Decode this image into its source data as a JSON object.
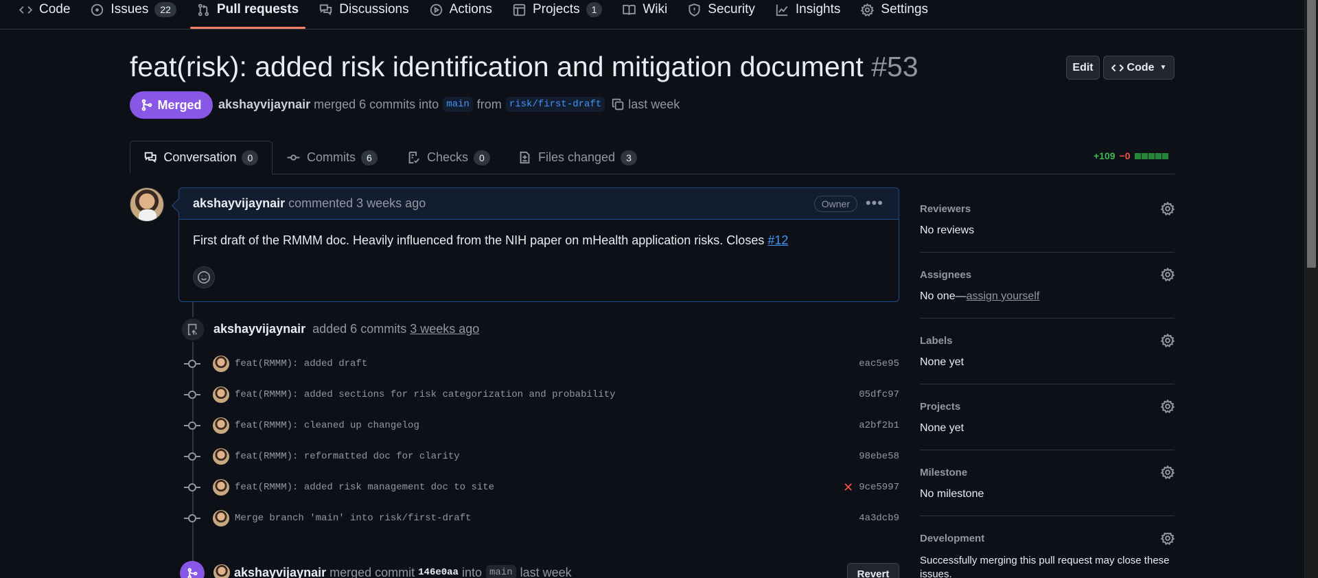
{
  "nav": {
    "items": [
      {
        "label": "Code",
        "icon": "code-icon"
      },
      {
        "label": "Issues",
        "icon": "issue-icon",
        "count": "22"
      },
      {
        "label": "Pull requests",
        "icon": "git-pull-request-icon",
        "active": true
      },
      {
        "label": "Discussions",
        "icon": "comment-discussion-icon"
      },
      {
        "label": "Actions",
        "icon": "play-icon"
      },
      {
        "label": "Projects",
        "icon": "table-icon",
        "count": "1"
      },
      {
        "label": "Wiki",
        "icon": "book-icon"
      },
      {
        "label": "Security",
        "icon": "shield-icon"
      },
      {
        "label": "Insights",
        "icon": "graph-icon"
      },
      {
        "label": "Settings",
        "icon": "gear-icon"
      }
    ]
  },
  "pr": {
    "title": "feat(risk): added risk identification and mitigation document",
    "number": "#53",
    "edit_label": "Edit",
    "code_label": "Code",
    "state": "Merged",
    "author": "akshayvijaynair",
    "merge_text": "merged 6 commits into",
    "base_branch": "main",
    "from_text": "from",
    "head_branch": "risk/first-draft",
    "when": "last week"
  },
  "tabs": [
    {
      "label": "Conversation",
      "count": "0",
      "icon": "comment-discussion-icon"
    },
    {
      "label": "Commits",
      "count": "6",
      "icon": "git-commit-icon"
    },
    {
      "label": "Checks",
      "count": "0",
      "icon": "checklist-icon"
    },
    {
      "label": "Files changed",
      "count": "3",
      "icon": "file-diff-icon"
    }
  ],
  "diffstat": {
    "additions": "+109",
    "deletions": "−0",
    "accent": "#238636"
  },
  "comment": {
    "author": "akshayvijaynair",
    "action": "commented 3 weeks ago",
    "badge": "Owner",
    "body": "First draft of the RMMM doc. Heavily influenced from the NIH paper on mHealth application risks. Closes ",
    "link": "#12"
  },
  "push_event": {
    "author": "akshayvijaynair",
    "text": "added 6 commits",
    "when": "3 weeks ago"
  },
  "commits": [
    {
      "message": "feat(RMMM): added draft",
      "sha": "eac5e95",
      "status": ""
    },
    {
      "message": "feat(RMMM): added sections for risk categorization and probability",
      "sha": "05dfc97",
      "status": ""
    },
    {
      "message": "feat(RMMM): cleaned up changelog",
      "sha": "a2bf2b1",
      "status": ""
    },
    {
      "message": "feat(RMMM): reformatted doc for clarity",
      "sha": "98ebe58",
      "status": ""
    },
    {
      "message": "feat(RMMM): added risk management doc to site",
      "sha": "9ce5997",
      "status": "✕"
    },
    {
      "message": "Merge branch 'main' into risk/first-draft",
      "sha": "4a3dcb9",
      "status": ""
    }
  ],
  "merge_event": {
    "author": "akshayvijaynair",
    "text": "merged commit",
    "sha": "146e0aa",
    "into": "into",
    "branch": "main",
    "when": "last week",
    "revert_label": "Revert"
  },
  "sidebar": [
    {
      "title": "Reviewers",
      "value": "No reviews"
    },
    {
      "title": "Assignees",
      "value": "No one—",
      "link": "assign yourself"
    },
    {
      "title": "Labels",
      "value": "None yet"
    },
    {
      "title": "Projects",
      "value": "None yet"
    },
    {
      "title": "Milestone",
      "value": "No milestone"
    },
    {
      "title": "Development",
      "value": "Successfully merging this pull request may close these issues."
    }
  ]
}
